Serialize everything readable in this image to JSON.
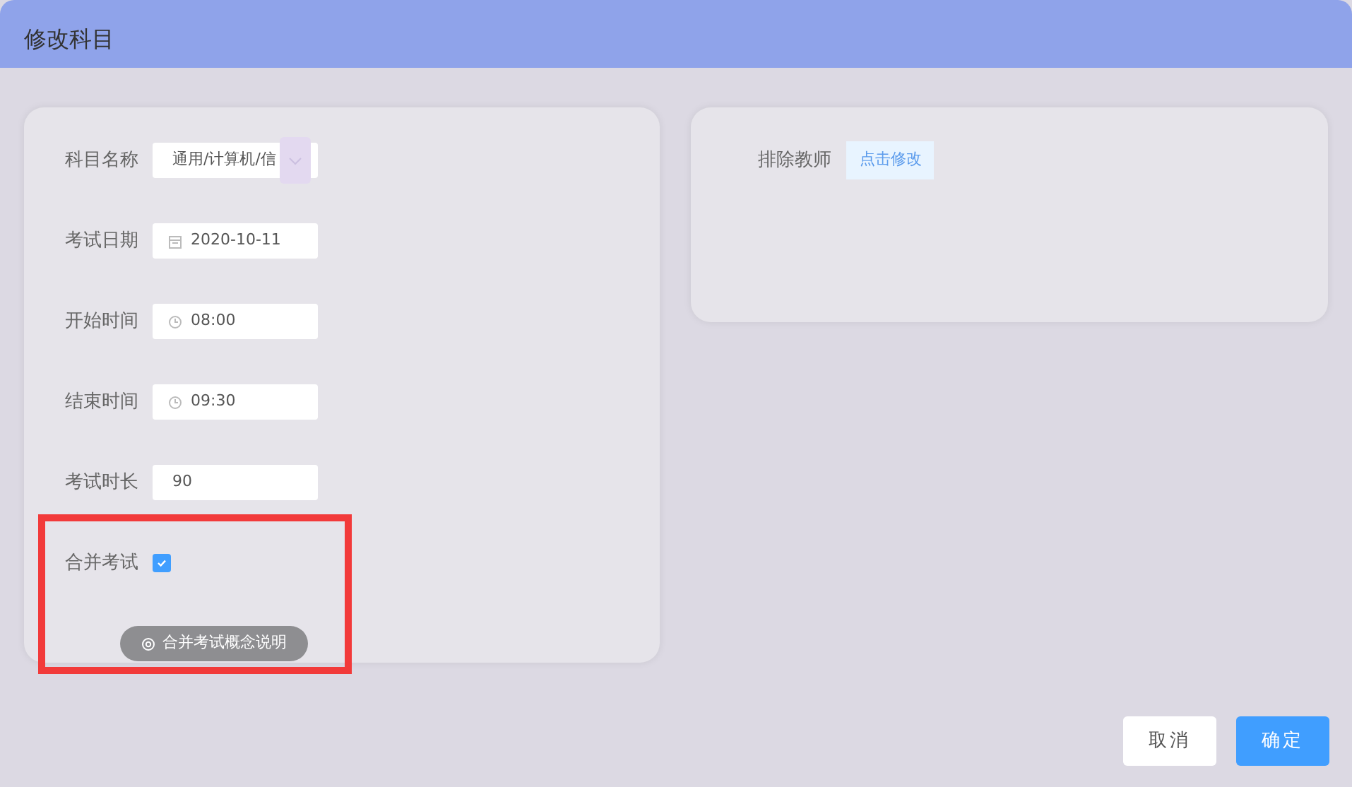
{
  "dialog": {
    "title": "修改科目"
  },
  "fields": [
    {
      "label": "科目名称",
      "kind": "select",
      "value": "通用/计算机/信"
    },
    {
      "label": "考试日期",
      "kind": "date",
      "value": "2020-10-11"
    },
    {
      "label": "开始时间",
      "kind": "time",
      "value": "08:00"
    },
    {
      "label": "结束时间",
      "kind": "time",
      "value": "09:30"
    },
    {
      "label": "考试时长",
      "kind": "text",
      "value": "90"
    },
    {
      "label": "合并考试",
      "kind": "checkbox",
      "checked": true
    }
  ],
  "help_chip": "合并考试概念说明",
  "exclude_teachers": {
    "label": "排除教师",
    "link": "点击修改"
  },
  "buttons": [
    {
      "label": "取消",
      "kind": "secondary"
    },
    {
      "label": "确定",
      "kind": "primary"
    }
  ]
}
